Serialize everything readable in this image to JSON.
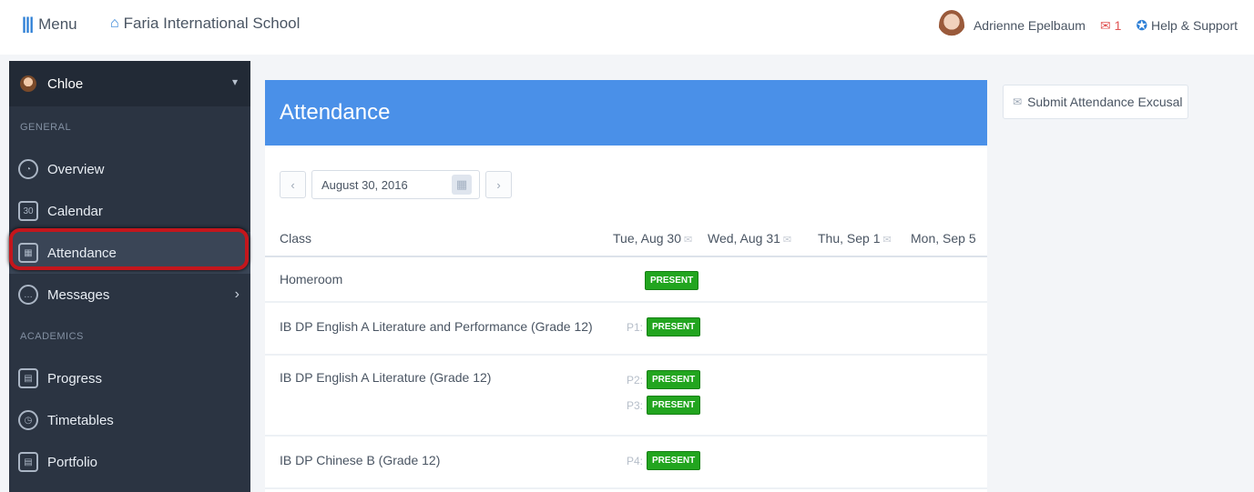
{
  "topbar": {
    "menu_label": "Menu",
    "school_name": "Faria International School",
    "user_name": "Adrienne Epelbaum",
    "mail_count": "1",
    "help_label": "Help & Support"
  },
  "sidebar": {
    "user": "Chloe",
    "section_general": "GENERAL",
    "section_academics": "ACADEMICS",
    "items": [
      {
        "label": "Overview",
        "icon": "gauge-icon"
      },
      {
        "label": "Calendar",
        "icon": "calendar-icon"
      },
      {
        "label": "Attendance",
        "icon": "attendance-icon"
      },
      {
        "label": "Messages",
        "icon": "chat-icon"
      },
      {
        "label": "Progress",
        "icon": "book-icon"
      },
      {
        "label": "Timetables",
        "icon": "clock-icon"
      },
      {
        "label": "Portfolio",
        "icon": "book-icon"
      }
    ],
    "active": "Attendance"
  },
  "main": {
    "title": "Attendance",
    "date_value": "August 30, 2016",
    "columns": [
      "Class",
      "Tue, Aug 30",
      "Wed, Aug 31",
      "Thu, Sep 1",
      "Mon, Sep 5"
    ],
    "rows": [
      {
        "class": "Homeroom",
        "entries": [
          {
            "period": "",
            "status": "PRESENT"
          }
        ]
      },
      {
        "class": "IB DP English A Literature and Performance (Grade 12)",
        "entries": [
          {
            "period": "P1:",
            "status": "PRESENT"
          }
        ]
      },
      {
        "class": "IB DP English A Literature (Grade 12)",
        "entries": [
          {
            "period": "P2:",
            "status": "PRESENT"
          },
          {
            "period": "P3:",
            "status": "PRESENT"
          }
        ]
      },
      {
        "class": "IB DP Chinese B (Grade 12)",
        "entries": [
          {
            "period": "P4:",
            "status": "PRESENT"
          }
        ]
      }
    ]
  },
  "right_panel": {
    "excusal_button": "Submit Attendance Excusal"
  },
  "colors": {
    "accent_blue": "#4a90e8",
    "sidebar_bg": "#2b3442",
    "present_green": "#22a51f",
    "highlight_red": "#c4161c"
  }
}
